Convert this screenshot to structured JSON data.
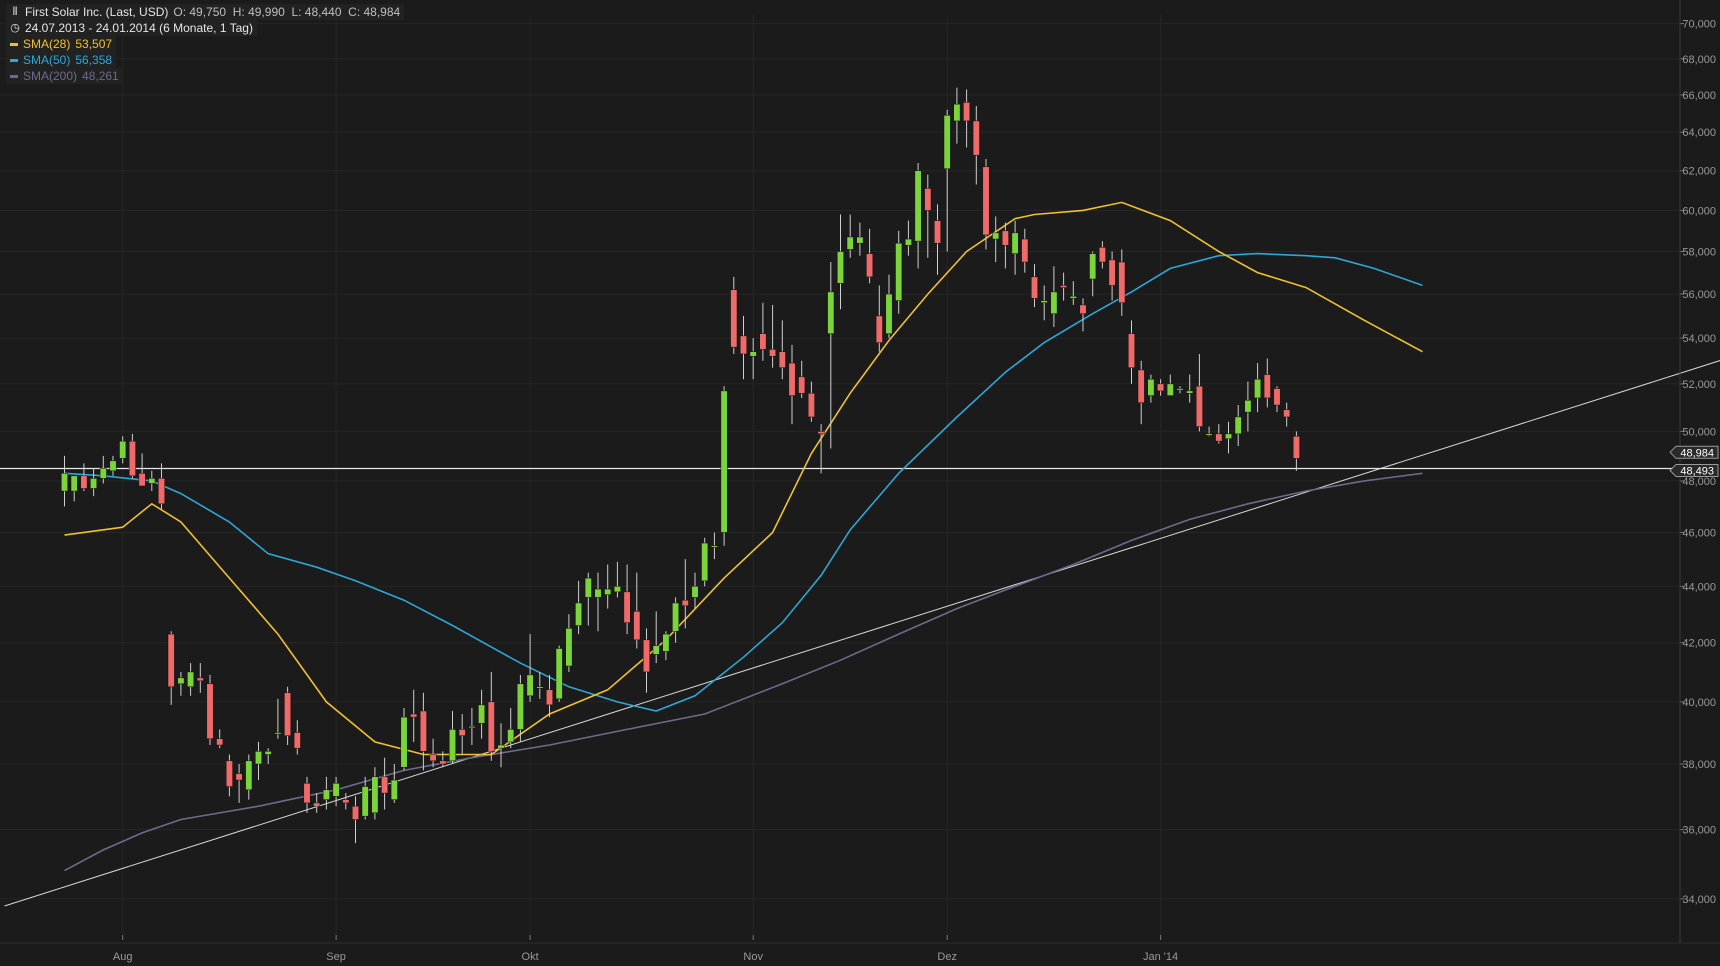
{
  "header": {
    "title_line": "First Solar Inc. (Last, USD)",
    "ohlc_line": "O: 49,750  H: 49,990  L: 48,440  C: 48,984",
    "period_line": "24.07.2013 - 24.01.2014 (6 Monate, 1 Tag)",
    "icons": {
      "title": "bar-chart-icon",
      "period": "clock-icon"
    }
  },
  "legend": [
    {
      "label": "SMA(28)",
      "value": "53,507",
      "color": "#f0c030"
    },
    {
      "label": "SMA(50)",
      "value": "56,358",
      "color": "#2ea6d6"
    },
    {
      "label": "SMA(200)",
      "value": "48,261",
      "color": "#6f6a8c"
    }
  ],
  "colors": {
    "up": "#7ad43a",
    "down": "#f06a6a",
    "bg": "#1b1b1b",
    "grid": "#262626",
    "trend": "#d8d8d8",
    "horizontal": "#e8e8e8"
  },
  "chart_data": {
    "type": "candlestick",
    "ylim": [
      33,
      70.5
    ],
    "y_ticks": [
      34,
      36,
      38,
      40,
      42,
      44,
      46,
      48,
      50,
      52,
      54,
      56,
      58,
      60,
      62,
      64,
      66,
      68,
      70
    ],
    "y_tick_labels": [
      "34,000",
      "36,000",
      "38,000",
      "40,000",
      "42,000",
      "44,000",
      "46,000",
      "48,000",
      "50,000",
      "52,000",
      "54,000",
      "56,000",
      "58,000",
      "60,000",
      "62,000",
      "64,000",
      "66,000",
      "68,000",
      "70,000"
    ],
    "x_labels": [
      "Aug",
      "Sep",
      "Okt",
      "Nov",
      "Dez",
      "Jan '14"
    ],
    "x_label_index": [
      6,
      28,
      48,
      71,
      91,
      113
    ],
    "candles": [
      [
        47.6,
        49.0,
        47.0,
        48.3
      ],
      [
        47.6,
        48.2,
        47.2,
        48.2
      ],
      [
        48.2,
        48.7,
        47.6,
        47.7
      ],
      [
        47.7,
        48.5,
        47.4,
        48.1
      ],
      [
        48.1,
        49.0,
        47.9,
        48.5
      ],
      [
        48.4,
        49.0,
        48.2,
        48.8
      ],
      [
        48.9,
        49.8,
        48.7,
        49.6
      ],
      [
        49.6,
        49.9,
        48.1,
        48.2
      ],
      [
        48.3,
        49.1,
        47.8,
        47.8
      ],
      [
        47.9,
        48.4,
        47.6,
        48.1
      ],
      [
        48.1,
        48.7,
        46.9,
        47.1
      ],
      [
        42.3,
        42.4,
        39.9,
        40.5
      ],
      [
        40.6,
        41.0,
        40.2,
        40.8
      ],
      [
        40.5,
        41.3,
        40.2,
        41.0
      ],
      [
        40.8,
        41.3,
        40.3,
        40.7
      ],
      [
        40.6,
        40.9,
        38.6,
        38.8
      ],
      [
        38.8,
        39.1,
        38.5,
        38.6
      ],
      [
        38.1,
        38.3,
        37.0,
        37.3
      ],
      [
        37.7,
        38.0,
        36.8,
        37.5
      ],
      [
        37.2,
        38.3,
        36.9,
        38.1
      ],
      [
        38.0,
        38.7,
        37.5,
        38.4
      ],
      [
        38.3,
        38.5,
        38.0,
        38.4
      ],
      [
        39.0,
        40.1,
        38.8,
        39.0
      ],
      [
        40.3,
        40.5,
        38.6,
        38.9
      ],
      [
        39.0,
        39.4,
        38.3,
        38.5
      ],
      [
        37.4,
        37.6,
        36.5,
        36.8
      ],
      [
        36.8,
        37.1,
        36.5,
        36.7
      ],
      [
        36.9,
        37.6,
        36.6,
        37.2
      ],
      [
        37.0,
        37.6,
        36.7,
        37.4
      ],
      [
        36.9,
        37.1,
        36.6,
        36.8
      ],
      [
        36.7,
        37.0,
        35.6,
        36.3
      ],
      [
        36.4,
        37.6,
        36.3,
        37.3
      ],
      [
        36.5,
        37.9,
        36.3,
        37.6
      ],
      [
        37.6,
        38.2,
        36.6,
        37.1
      ],
      [
        36.9,
        38.0,
        36.8,
        37.5
      ],
      [
        37.9,
        39.8,
        37.8,
        39.5
      ],
      [
        39.6,
        40.4,
        38.7,
        39.5
      ],
      [
        39.7,
        40.3,
        37.8,
        38.4
      ],
      [
        38.3,
        38.8,
        37.9,
        38.1
      ],
      [
        38.1,
        38.4,
        37.9,
        38.0
      ],
      [
        38.1,
        39.7,
        38.0,
        39.1
      ],
      [
        39.1,
        39.6,
        38.3,
        38.9
      ],
      [
        39.2,
        39.8,
        38.6,
        39.2
      ],
      [
        39.3,
        40.4,
        38.8,
        39.9
      ],
      [
        40.0,
        41.0,
        38.1,
        38.4
      ],
      [
        38.5,
        39.3,
        37.9,
        38.6
      ],
      [
        38.7,
        39.8,
        38.5,
        39.1
      ],
      [
        39.1,
        40.9,
        38.7,
        40.6
      ],
      [
        40.2,
        42.3,
        40.0,
        40.9
      ],
      [
        40.5,
        41.0,
        40.1,
        40.5
      ],
      [
        40.4,
        40.9,
        39.5,
        39.9
      ],
      [
        40.1,
        41.9,
        40.0,
        41.8
      ],
      [
        41.2,
        43.0,
        41.0,
        42.5
      ],
      [
        42.6,
        44.2,
        42.3,
        43.4
      ],
      [
        43.6,
        44.5,
        42.6,
        44.3
      ],
      [
        43.6,
        44.5,
        42.4,
        43.9
      ],
      [
        43.7,
        44.8,
        43.2,
        43.9
      ],
      [
        43.8,
        44.9,
        43.6,
        44.0
      ],
      [
        43.8,
        44.8,
        42.3,
        42.7
      ],
      [
        43.1,
        44.5,
        41.8,
        42.1
      ],
      [
        42.1,
        42.5,
        40.3,
        41.0
      ],
      [
        41.6,
        43.1,
        41.3,
        41.9
      ],
      [
        41.7,
        42.4,
        41.4,
        42.3
      ],
      [
        42.4,
        43.6,
        42.0,
        43.4
      ],
      [
        43.5,
        45.0,
        42.5,
        43.3
      ],
      [
        43.6,
        44.5,
        43.2,
        44.0
      ],
      [
        44.2,
        45.8,
        44.0,
        45.6
      ],
      [
        45.5,
        46.0,
        45.0,
        45.5
      ],
      [
        46.0,
        51.9,
        45.5,
        51.7
      ],
      [
        56.2,
        56.8,
        53.3,
        53.6
      ],
      [
        54.1,
        55.0,
        52.2,
        53.3
      ],
      [
        53.2,
        54.0,
        52.2,
        53.4
      ],
      [
        54.2,
        55.6,
        53.0,
        53.5
      ],
      [
        53.5,
        55.5,
        52.7,
        53.2
      ],
      [
        53.4,
        54.8,
        52.2,
        52.7
      ],
      [
        52.9,
        53.7,
        50.3,
        51.5
      ],
      [
        52.3,
        53.0,
        51.4,
        51.6
      ],
      [
        51.6,
        52.1,
        50.4,
        50.6
      ],
      [
        50.0,
        50.3,
        48.3,
        49.9
      ],
      [
        54.2,
        57.5,
        49.3,
        56.1
      ],
      [
        56.5,
        59.8,
        55.3,
        58.0
      ],
      [
        58.1,
        59.8,
        57.7,
        58.7
      ],
      [
        58.4,
        59.4,
        57.8,
        58.7
      ],
      [
        57.9,
        59.1,
        56.5,
        56.8
      ],
      [
        55.0,
        56.4,
        53.4,
        53.8
      ],
      [
        54.2,
        56.9,
        54.0,
        56.0
      ],
      [
        55.7,
        59.0,
        55.1,
        58.4
      ],
      [
        58.3,
        59.5,
        57.8,
        58.6
      ],
      [
        58.5,
        62.4,
        57.2,
        62.0
      ],
      [
        61.1,
        61.8,
        57.7,
        60.0
      ],
      [
        59.5,
        60.3,
        56.9,
        58.4
      ],
      [
        62.1,
        65.2,
        58.0,
        64.9
      ],
      [
        64.6,
        66.4,
        63.4,
        65.5
      ],
      [
        65.6,
        66.3,
        63.2,
        64.6
      ],
      [
        64.6,
        65.4,
        61.3,
        62.8
      ],
      [
        62.2,
        62.6,
        58.1,
        58.8
      ],
      [
        58.6,
        59.7,
        57.5,
        58.9
      ],
      [
        59.0,
        59.4,
        57.2,
        58.3
      ],
      [
        57.9,
        59.5,
        56.9,
        58.9
      ],
      [
        58.6,
        59.1,
        57.0,
        57.5
      ],
      [
        56.8,
        57.4,
        55.4,
        55.8
      ],
      [
        55.6,
        56.4,
        54.8,
        55.7
      ],
      [
        55.1,
        57.3,
        54.5,
        56.1
      ],
      [
        56.4,
        57.0,
        55.7,
        56.3
      ],
      [
        55.8,
        56.6,
        55.5,
        55.9
      ],
      [
        55.5,
        55.8,
        54.3,
        55.1
      ],
      [
        56.7,
        58.0,
        55.9,
        57.9
      ],
      [
        58.2,
        58.5,
        57.2,
        57.5
      ],
      [
        57.6,
        58.0,
        55.7,
        56.4
      ],
      [
        57.5,
        58.1,
        55.0,
        55.6
      ],
      [
        54.2,
        54.8,
        52.0,
        52.7
      ],
      [
        52.6,
        53.0,
        50.3,
        51.2
      ],
      [
        51.5,
        52.4,
        51.2,
        52.2
      ],
      [
        52.0,
        52.2,
        51.5,
        51.7
      ],
      [
        51.5,
        52.4,
        51.6,
        52.0
      ],
      [
        51.8,
        51.9,
        51.6,
        51.8
      ],
      [
        51.6,
        52.4,
        51.2,
        51.7
      ],
      [
        51.9,
        53.3,
        50.0,
        50.2
      ],
      [
        49.9,
        50.2,
        49.8,
        49.9
      ],
      [
        49.9,
        50.3,
        49.5,
        49.6
      ],
      [
        49.7,
        50.4,
        49.1,
        49.9
      ],
      [
        49.9,
        51.1,
        49.4,
        50.6
      ],
      [
        50.8,
        52.1,
        50.0,
        51.3
      ],
      [
        51.4,
        52.9,
        50.8,
        52.2
      ],
      [
        52.4,
        53.1,
        51.0,
        51.4
      ],
      [
        51.8,
        51.9,
        50.8,
        51.1
      ],
      [
        50.9,
        51.2,
        50.2,
        50.6
      ],
      [
        49.8,
        50.0,
        48.4,
        48.9
      ]
    ],
    "sma28": [
      [
        0,
        45.9
      ],
      [
        6,
        46.2
      ],
      [
        9,
        47.1
      ],
      [
        12,
        46.4
      ],
      [
        17,
        44.3
      ],
      [
        22,
        42.3
      ],
      [
        27,
        40.0
      ],
      [
        32,
        38.7
      ],
      [
        37,
        38.3
      ],
      [
        44,
        38.3
      ],
      [
        50,
        39.6
      ],
      [
        56,
        40.4
      ],
      [
        62,
        42.1
      ],
      [
        68,
        44.3
      ],
      [
        73,
        46.0
      ],
      [
        77,
        49.1
      ],
      [
        81,
        51.6
      ],
      [
        85,
        53.9
      ],
      [
        89,
        56.0
      ],
      [
        93,
        58.0
      ],
      [
        98,
        59.6
      ],
      [
        100,
        59.8
      ],
      [
        105,
        60.0
      ],
      [
        109,
        60.4
      ],
      [
        114,
        59.5
      ],
      [
        119,
        58.0
      ],
      [
        123,
        57.0
      ],
      [
        128,
        56.3
      ],
      [
        134,
        54.8
      ],
      [
        140,
        53.4
      ]
    ],
    "sma50": [
      [
        0,
        48.3
      ],
      [
        4,
        48.2
      ],
      [
        9,
        48.0
      ],
      [
        12,
        47.5
      ],
      [
        17,
        46.4
      ],
      [
        21,
        45.2
      ],
      [
        26,
        44.7
      ],
      [
        30,
        44.2
      ],
      [
        35,
        43.5
      ],
      [
        40,
        42.6
      ],
      [
        47,
        41.3
      ],
      [
        52,
        40.5
      ],
      [
        57,
        40.0
      ],
      [
        61,
        39.7
      ],
      [
        65,
        40.2
      ],
      [
        70,
        41.5
      ],
      [
        74,
        42.7
      ],
      [
        78,
        44.4
      ],
      [
        81,
        46.1
      ],
      [
        86,
        48.3
      ],
      [
        92,
        50.6
      ],
      [
        97,
        52.5
      ],
      [
        101,
        53.8
      ],
      [
        106,
        55.1
      ],
      [
        110,
        56.1
      ],
      [
        114,
        57.2
      ],
      [
        119,
        57.8
      ],
      [
        123,
        57.9
      ],
      [
        128,
        57.8
      ],
      [
        131,
        57.7
      ],
      [
        135,
        57.2
      ],
      [
        140,
        56.4
      ]
    ],
    "sma200": [
      [
        0,
        34.8
      ],
      [
        4,
        35.4
      ],
      [
        8,
        35.9
      ],
      [
        12,
        36.3
      ],
      [
        20,
        36.7
      ],
      [
        28,
        37.2
      ],
      [
        35,
        37.8
      ],
      [
        42,
        38.2
      ],
      [
        50,
        38.6
      ],
      [
        58,
        39.1
      ],
      [
        66,
        39.6
      ],
      [
        74,
        40.6
      ],
      [
        80,
        41.4
      ],
      [
        86,
        42.3
      ],
      [
        92,
        43.2
      ],
      [
        98,
        44.0
      ],
      [
        104,
        44.8
      ],
      [
        110,
        45.7
      ],
      [
        116,
        46.5
      ],
      [
        122,
        47.1
      ],
      [
        128,
        47.6
      ],
      [
        134,
        48.0
      ],
      [
        140,
        48.3
      ]
    ],
    "trendline": {
      "from": [
        0,
        33.8
      ],
      "to": [
        188,
        55.4
      ]
    },
    "horizontal_level": 48.493,
    "last_price_tags": [
      "48,984",
      "48,493"
    ]
  }
}
